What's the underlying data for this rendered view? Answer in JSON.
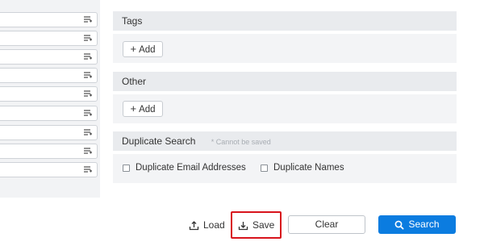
{
  "left_panel": {
    "fields": [
      "",
      "",
      "",
      "",
      "",
      "",
      "",
      "",
      ""
    ],
    "field_icon": "list-edit-icon"
  },
  "sections": {
    "tags": {
      "title": "Tags",
      "add_label": "Add"
    },
    "other": {
      "title": "Other",
      "add_label": "Add"
    },
    "duplicate": {
      "title": "Duplicate Search",
      "hint": "* Cannot be saved",
      "options": [
        "Duplicate Email Addresses",
        "Duplicate Names"
      ]
    }
  },
  "footer": {
    "load_label": "Load",
    "save_label": "Save",
    "clear_label": "Clear",
    "search_label": "Search",
    "accent_color": "#0b7ce0",
    "highlight_color": "#d8141c"
  }
}
